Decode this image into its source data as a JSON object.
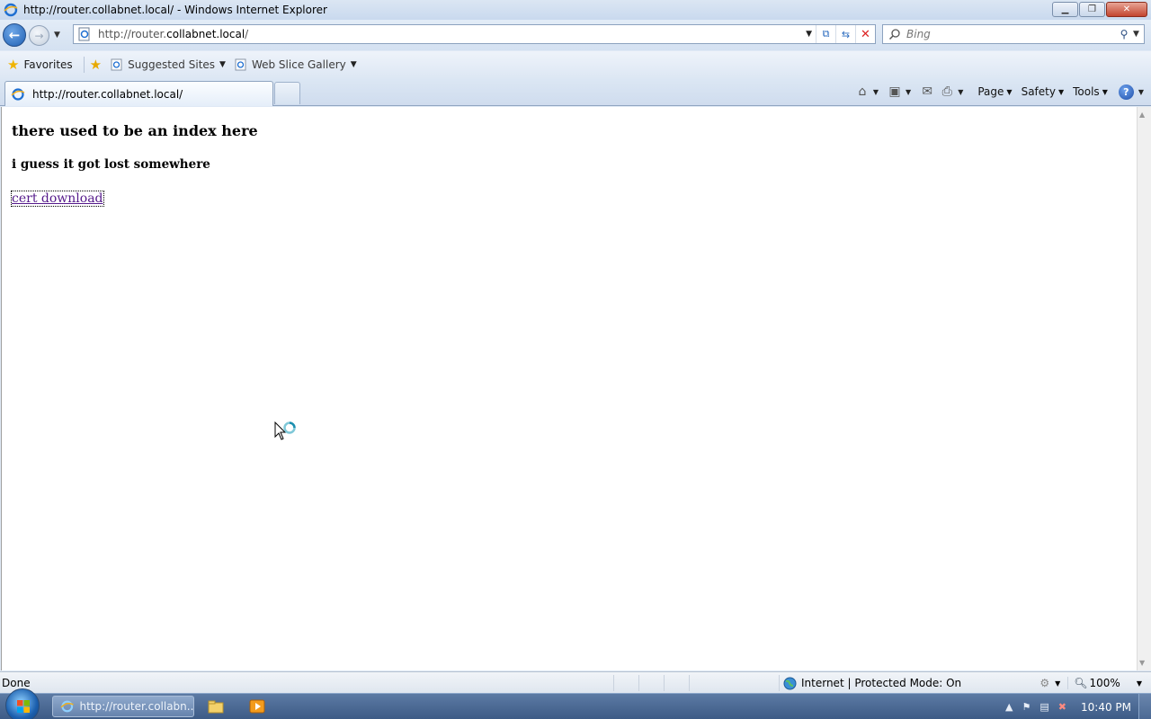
{
  "window": {
    "title": "http://router.collabnet.local/ - Windows Internet Explorer",
    "controls": [
      "minimize",
      "restore",
      "close"
    ]
  },
  "nav": {
    "url_prefix": "http://router.",
    "url_domain": "collabnet.local",
    "url_suffix": "/",
    "search_placeholder": "Bing"
  },
  "favorites_bar": {
    "favorites_label": "Favorites",
    "links": [
      {
        "label": "Suggested Sites"
      },
      {
        "label": "Web Slice Gallery"
      }
    ]
  },
  "tabs": [
    {
      "label": "http://router.collabnet.local/",
      "active": true
    }
  ],
  "command_bar": {
    "page_label": "Page",
    "safety_label": "Safety",
    "tools_label": "Tools",
    "help_glyph": "?"
  },
  "content": {
    "heading": "there used to be an index here",
    "subheading": "i guess it got lost somewhere",
    "link_text": "cert download"
  },
  "status_bar": {
    "status_text": "Done",
    "zone_text": "Internet | Protected Mode: On",
    "zoom": "100%"
  },
  "taskbar": {
    "task_label": "http://router.collabn...",
    "clock": "10:40 PM"
  },
  "colors": {
    "link_visited": "#551a8b",
    "titlebar": "#c9d9ee",
    "taskbar": "#3d5b86"
  }
}
